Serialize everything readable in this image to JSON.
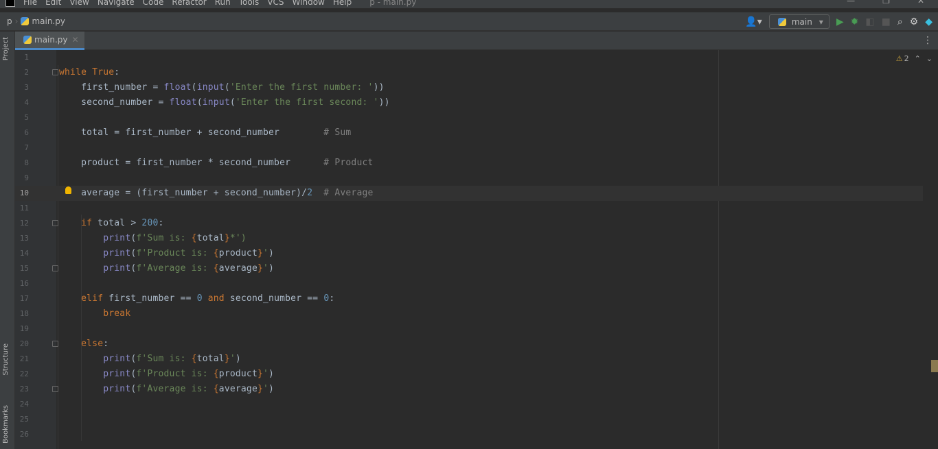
{
  "menu": {
    "items": [
      "File",
      "Edit",
      "View",
      "Navigate",
      "Code",
      "Refactor",
      "Run",
      "Tools",
      "VCS",
      "Window",
      "Help"
    ],
    "title": "p - main.py"
  },
  "nav": {
    "project": "p",
    "file": "main.py",
    "run_config": "main"
  },
  "tab": {
    "label": "main.py"
  },
  "side": {
    "project": "Project",
    "structure": "Structure",
    "bookmarks": "Bookmarks"
  },
  "inspections": {
    "warnings": "2"
  },
  "colors": {
    "keyword": "#cc7832",
    "builtin": "#8888c6",
    "string": "#6a8759",
    "number": "#6897bb",
    "comment": "#808080",
    "text": "#a9b7c6"
  },
  "current_line": 10,
  "code": [
    [],
    [
      [
        "while ",
        "kw"
      ],
      [
        "True",
        "kw"
      ],
      [
        ":",
        ""
      ]
    ],
    [
      [
        "    first_number = ",
        ""
      ],
      [
        "float",
        "bi"
      ],
      [
        "(",
        ""
      ],
      [
        "input",
        "bi"
      ],
      [
        "(",
        ""
      ],
      [
        "'Enter the first number: '",
        "st"
      ],
      [
        "))",
        ""
      ]
    ],
    [
      [
        "    second_number = ",
        ""
      ],
      [
        "float",
        "bi"
      ],
      [
        "(",
        ""
      ],
      [
        "input",
        "bi"
      ],
      [
        "(",
        ""
      ],
      [
        "'Enter the first second: '",
        "st"
      ],
      [
        "))",
        ""
      ]
    ],
    [],
    [
      [
        "    total = first_number + second_number        ",
        ""
      ],
      [
        "# Sum",
        "cm"
      ]
    ],
    [],
    [
      [
        "    product = first_number * second_number      ",
        ""
      ],
      [
        "# Product",
        "cm"
      ]
    ],
    [],
    [
      [
        "    average = (first_number + second_number)/",
        ""
      ],
      [
        "2",
        "nm"
      ],
      [
        "  ",
        ""
      ],
      [
        "# Average",
        "cm"
      ]
    ],
    [],
    [
      [
        "    ",
        ""
      ],
      [
        "if ",
        "kw"
      ],
      [
        "total > ",
        ""
      ],
      [
        "200",
        "nm"
      ],
      [
        ":",
        ""
      ]
    ],
    [
      [
        "        ",
        ""
      ],
      [
        "print",
        "bi"
      ],
      [
        "(",
        ""
      ],
      [
        "f'Sum is: ",
        "st"
      ],
      [
        "{",
        "br"
      ],
      [
        "total",
        ""
      ],
      [
        "}",
        "br"
      ],
      [
        "*')",
        "st"
      ]
    ],
    [
      [
        "        ",
        ""
      ],
      [
        "print",
        "bi"
      ],
      [
        "(",
        ""
      ],
      [
        "f'Product is: ",
        "st"
      ],
      [
        "{",
        "br"
      ],
      [
        "product",
        ""
      ],
      [
        "}",
        "br"
      ],
      [
        "'",
        "st"
      ],
      [
        ")",
        ""
      ]
    ],
    [
      [
        "        ",
        ""
      ],
      [
        "print",
        "bi"
      ],
      [
        "(",
        ""
      ],
      [
        "f'Average is: ",
        "st"
      ],
      [
        "{",
        "br"
      ],
      [
        "average",
        ""
      ],
      [
        "}",
        "br"
      ],
      [
        "'",
        "st"
      ],
      [
        ")",
        ""
      ]
    ],
    [],
    [
      [
        "    ",
        ""
      ],
      [
        "elif ",
        "kw"
      ],
      [
        "first_number == ",
        ""
      ],
      [
        "0",
        "nm"
      ],
      [
        " ",
        ""
      ],
      [
        "and",
        "kw"
      ],
      [
        " second_number == ",
        ""
      ],
      [
        "0",
        "nm"
      ],
      [
        ":",
        ""
      ]
    ],
    [
      [
        "        ",
        ""
      ],
      [
        "break",
        "kw"
      ]
    ],
    [],
    [
      [
        "    ",
        ""
      ],
      [
        "else",
        "kw"
      ],
      [
        ":",
        ""
      ]
    ],
    [
      [
        "        ",
        ""
      ],
      [
        "print",
        "bi"
      ],
      [
        "(",
        ""
      ],
      [
        "f'Sum is: ",
        "st"
      ],
      [
        "{",
        "br"
      ],
      [
        "total",
        ""
      ],
      [
        "}",
        "br"
      ],
      [
        "'",
        "st"
      ],
      [
        ")",
        ""
      ]
    ],
    [
      [
        "        ",
        ""
      ],
      [
        "print",
        "bi"
      ],
      [
        "(",
        ""
      ],
      [
        "f'Product is: ",
        "st"
      ],
      [
        "{",
        "br"
      ],
      [
        "product",
        ""
      ],
      [
        "}",
        "br"
      ],
      [
        "'",
        "st"
      ],
      [
        ")",
        ""
      ]
    ],
    [
      [
        "        ",
        ""
      ],
      [
        "print",
        "bi"
      ],
      [
        "(",
        ""
      ],
      [
        "f'Average is: ",
        "st"
      ],
      [
        "{",
        "br"
      ],
      [
        "average",
        ""
      ],
      [
        "}",
        "br"
      ],
      [
        "'",
        "st"
      ],
      [
        ")",
        ""
      ]
    ],
    [],
    [],
    []
  ]
}
